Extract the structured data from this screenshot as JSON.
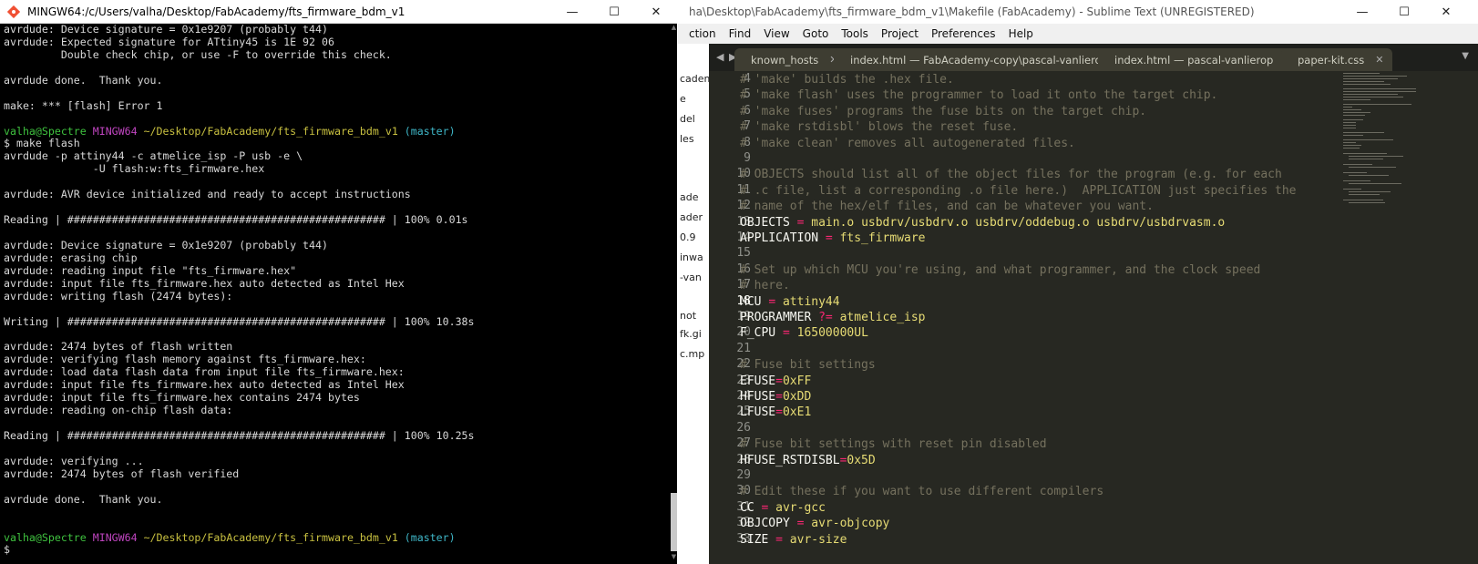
{
  "terminal": {
    "title": "MINGW64:/c/Users/valha/Desktop/FabAcademy/fts_firmware_bdm_v1",
    "prompt": {
      "user": "valha@Spectre",
      "host": "MINGW64",
      "path": "~/Desktop/FabAcademy/fts_firmware_bdm_v1",
      "branch": "(master)"
    },
    "lines": [
      "avrdude: Device signature = 0x1e9207 (probably t44)",
      "avrdude: Expected signature for ATtiny45 is 1E 92 06",
      "         Double check chip, or use -F to override this check.",
      "",
      "avrdude done.  Thank you.",
      "",
      "make: *** [flash] Error 1",
      "",
      "$ make flash",
      "avrdude -p attiny44 -c atmelice_isp -P usb -e \\",
      "              -U flash:w:fts_firmware.hex",
      "",
      "avrdude: AVR device initialized and ready to accept instructions",
      "",
      "Reading | ################################################## | 100% 0.01s",
      "",
      "avrdude: Device signature = 0x1e9207 (probably t44)",
      "avrdude: erasing chip",
      "avrdude: reading input file \"fts_firmware.hex\"",
      "avrdude: input file fts_firmware.hex auto detected as Intel Hex",
      "avrdude: writing flash (2474 bytes):",
      "",
      "Writing | ################################################## | 100% 10.38s",
      "",
      "avrdude: 2474 bytes of flash written",
      "avrdude: verifying flash memory against fts_firmware.hex:",
      "avrdude: load data flash data from input file fts_firmware.hex:",
      "avrdude: input file fts_firmware.hex auto detected as Intel Hex",
      "avrdude: input file fts_firmware.hex contains 2474 bytes",
      "avrdude: reading on-chip flash data:",
      "",
      "Reading | ################################################## | 100% 10.25s",
      "",
      "avrdude: verifying ...",
      "avrdude: 2474 bytes of flash verified",
      "",
      "avrdude done.  Thank you.",
      "",
      "",
      "",
      "$ "
    ]
  },
  "explorer": {
    "items": [
      "cademy",
      "e",
      "del",
      "les",
      "ade",
      "ader",
      "0.9",
      "inwa",
      "-van",
      "not",
      "fk.gi",
      "c.mp"
    ]
  },
  "sublime": {
    "title": "ha\\Desktop\\FabAcademy\\fts_firmware_bdm_v1\\Makefile (FabAcademy) - Sublime Text (UNREGISTERED)",
    "menu": [
      "ction",
      "Find",
      "View",
      "Goto",
      "Tools",
      "Project",
      "Preferences",
      "Help"
    ],
    "tabs": [
      {
        "label": "known_hosts"
      },
      {
        "label": "index.html — FabAcademy-copy\\pascal-vanlierop"
      },
      {
        "label": "index.html — pascal-vanlierop"
      },
      {
        "label": "paper-kit.css"
      }
    ],
    "line_numbers": [
      "4",
      "5",
      "6",
      "7",
      "8",
      "9",
      "10",
      "11",
      "12",
      "13",
      "14",
      "15",
      "16",
      "17",
      "18",
      "19",
      "20",
      "21",
      "22",
      "23",
      "24",
      "25",
      "26",
      "27",
      "28",
      "29",
      "30",
      "31",
      "32",
      "33"
    ],
    "current_line": "18",
    "code": {
      "l4": "# 'make' builds the .hex file.",
      "l5": "# 'make flash' uses the programmer to load it onto the target chip.",
      "l6": "# 'make fuses' programs the fuse bits on the target chip.",
      "l7": "# 'make rstdisbl' blows the reset fuse.",
      "l8": "# 'make clean' removes all autogenerated files.",
      "l10": "# OBJECTS should list all of the object files for the program (e.g. for each",
      "l11": "# .c file, list a corresponding .o file here.)  APPLICATION just specifies the",
      "l12": "# name of the hex/elf files, and can be whatever you want.",
      "l13_name": "OBJECTS",
      "l13_op": "=",
      "l13_val": "main.o usbdrv/usbdrv.o usbdrv/oddebug.o usbdrv/usbdrvasm.o",
      "l14_name": "APPLICATION",
      "l14_op": "=",
      "l14_val": "fts_firmware",
      "l16": "# Set up which MCU you're using, and what programmer, and the clock speed",
      "l17": "# here.",
      "l18_name": "MCU",
      "l18_op": "=",
      "l18_val": "attiny44",
      "l19_name": "PROGRAMMER",
      "l19_op": "?=",
      "l19_val": "atmelice_isp",
      "l20_name": "F_CPU",
      "l20_op": "=",
      "l20_val": "16500000UL",
      "l22": "# Fuse bit settings",
      "l23_name": "EFUSE",
      "l23_op": "=",
      "l23_val": "0xFF",
      "l24_name": "HFUSE",
      "l24_op": "=",
      "l24_val": "0xDD",
      "l25_name": "LFUSE",
      "l25_op": "=",
      "l25_val": "0xE1",
      "l27": "# Fuse bit settings with reset pin disabled",
      "l28_name": "HFUSE_RSTDISBL",
      "l28_op": "=",
      "l28_val": "0x5D",
      "l30": "# Edit these if you want to use different compilers",
      "l31_name": "CC",
      "l31_op": "=",
      "l31_val": "avr-gcc",
      "l32_name": "OBJCOPY",
      "l32_op": "=",
      "l32_val": "avr-objcopy",
      "l33_name": "SIZE",
      "l33_op": "=",
      "l33_val": "avr-size"
    }
  },
  "colors": {
    "terminal_bg": "#000000",
    "terminal_text": "#d8d8d8",
    "prompt_user": "#3fc23f",
    "prompt_host": "#c045c0",
    "prompt_path": "#c8c040",
    "prompt_branch": "#3fb7c8",
    "editor_bg": "#272822",
    "comment": "#75715e",
    "operator": "#f92672",
    "string": "#e6db74",
    "number": "#ae81ff"
  }
}
